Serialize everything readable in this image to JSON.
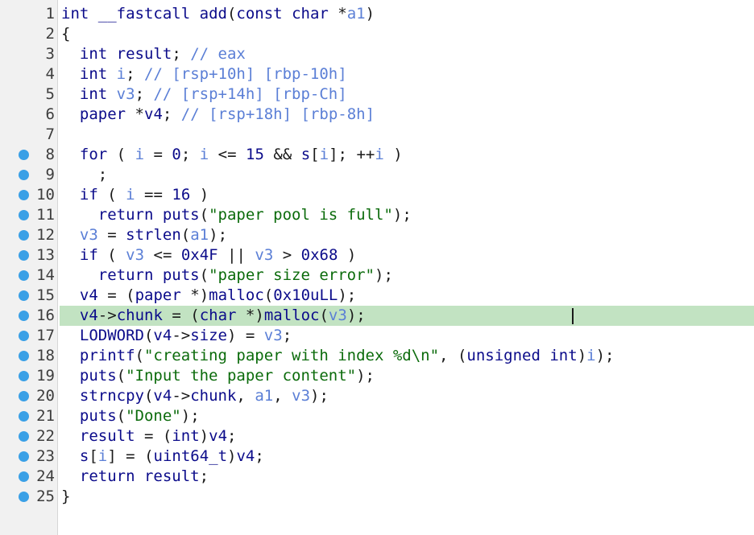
{
  "editor": {
    "colors": {
      "keyword": "#0b0b8a",
      "variable": "#5b7fd6",
      "comment": "#5b7fd6",
      "string": "#0b6b0b",
      "highlight": "#c2e3c2",
      "breakpoint": "#3aa0e6"
    },
    "highlighted_line": 16,
    "lines": [
      {
        "n": "1",
        "bp": false,
        "text": "int __fastcall add(const char *a1)"
      },
      {
        "n": "2",
        "bp": false,
        "text": "{"
      },
      {
        "n": "3",
        "bp": false,
        "text": "  int result; // eax"
      },
      {
        "n": "4",
        "bp": false,
        "text": "  int i; // [rsp+10h] [rbp-10h]"
      },
      {
        "n": "5",
        "bp": false,
        "text": "  int v3; // [rsp+14h] [rbp-Ch]"
      },
      {
        "n": "6",
        "bp": false,
        "text": "  paper *v4; // [rsp+18h] [rbp-8h]"
      },
      {
        "n": "7",
        "bp": false,
        "text": ""
      },
      {
        "n": "8",
        "bp": true,
        "text": "  for ( i = 0; i <= 15 && s[i]; ++i )"
      },
      {
        "n": "9",
        "bp": true,
        "text": "    ;"
      },
      {
        "n": "10",
        "bp": true,
        "text": "  if ( i == 16 )"
      },
      {
        "n": "11",
        "bp": true,
        "text": "    return puts(\"paper pool is full\");"
      },
      {
        "n": "12",
        "bp": true,
        "text": "  v3 = strlen(a1);"
      },
      {
        "n": "13",
        "bp": true,
        "text": "  if ( v3 <= 0x4F || v3 > 0x68 )"
      },
      {
        "n": "14",
        "bp": true,
        "text": "    return puts(\"paper size error\");"
      },
      {
        "n": "15",
        "bp": true,
        "text": "  v4 = (paper *)malloc(0x10uLL);"
      },
      {
        "n": "16",
        "bp": true,
        "text": "  v4->chunk = (char *)malloc(v3);"
      },
      {
        "n": "17",
        "bp": true,
        "text": "  LODWORD(v4->size) = v3;"
      },
      {
        "n": "18",
        "bp": true,
        "text": "  printf(\"creating paper with index %d\\n\", (unsigned int)i);"
      },
      {
        "n": "19",
        "bp": true,
        "text": "  puts(\"Input the paper content\");"
      },
      {
        "n": "20",
        "bp": true,
        "text": "  strncpy(v4->chunk, a1, v3);"
      },
      {
        "n": "21",
        "bp": true,
        "text": "  puts(\"Done\");"
      },
      {
        "n": "22",
        "bp": true,
        "text": "  result = (int)v4;"
      },
      {
        "n": "23",
        "bp": true,
        "text": "  s[i] = (uint64_t)v4;"
      },
      {
        "n": "24",
        "bp": true,
        "text": "  return result;"
      },
      {
        "n": "25",
        "bp": true,
        "text": "}"
      }
    ]
  }
}
